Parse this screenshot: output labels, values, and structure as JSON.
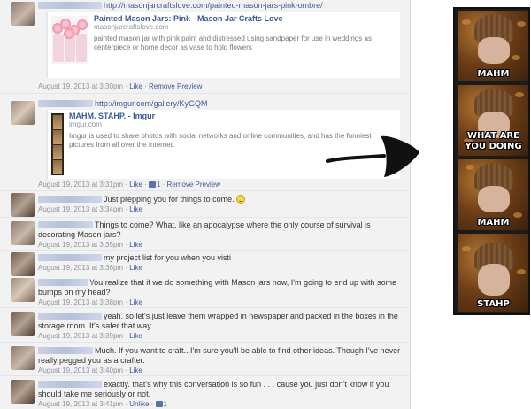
{
  "feed": {
    "post1": {
      "url": "http://masonjarcraftslove.com/painted-mason-jars-pink-ombre/",
      "preview_title": "Painted Mason Jars: Pink - Mason Jar Crafts Love",
      "preview_domain": "masonjarcraftslove.com",
      "preview_desc": "painted mason jar with pink paint and distressed using sandpaper for use in weddings as centerpiece or home decor as vase to hold flowers",
      "time": "August 19, 2013 at 3:30pm",
      "sep": " · ",
      "like": "Like",
      "remove": "Remove Preview"
    },
    "post2": {
      "url": "http://imgur.com/gallery/KyGQM",
      "preview_title": "MAHM. STAHP. - Imgur",
      "preview_domain": "imgur.com",
      "preview_desc": "Imgur is used to share photos with social networks and online communities, and has the funniest pictures from all over the Internet.",
      "time": "August 19, 2013 at 3:31pm",
      "sep": " · ",
      "like": "Like",
      "like_count": "1",
      "remove": "Remove Preview"
    },
    "comments": [
      {
        "text": "Just prepping you for things to come.",
        "time": "August 19, 2013 at 3:34pm",
        "like": "Like"
      },
      {
        "text": "Things to come? What, like an apocalypse where the only course of survival is decorating Mason jars?",
        "time": "August 19, 2013 at 3:35pm",
        "like": "Like"
      },
      {
        "text": "my project list for you when you visti",
        "time": "August 19, 2013 at 3:36pm",
        "like": "Like"
      },
      {
        "text": "You realize that if we do something with Mason jars now, I'm going to end up with some bumps on my head?",
        "time": "August 19, 2013 at 3:38pm",
        "like": "Like"
      },
      {
        "text": "yeah. so let's just leave them wrapped in newspaper and packed in the boxes in the storage room. It's safer that way.",
        "time": "August 19, 2013 at 3:39pm",
        "like": "Like"
      },
      {
        "text": "Much. If you want to craft...I'm sure you'll be able to find other ideas. Though I've never really pegged you as a crafter.",
        "time": "August 19, 2013 at 3:40pm",
        "like": "Like"
      },
      {
        "text": "exactly. that's why this conversation is so fun . . . cause you just don't know if you should take me seriously or not.",
        "time": "August 19, 2013 at 3:41pm",
        "like": "Unlike",
        "like_count": "1"
      }
    ]
  },
  "meme": {
    "captions": [
      "MAHM",
      "WHAT ARE YOU DOING",
      "MAHM",
      "STAHP"
    ]
  }
}
